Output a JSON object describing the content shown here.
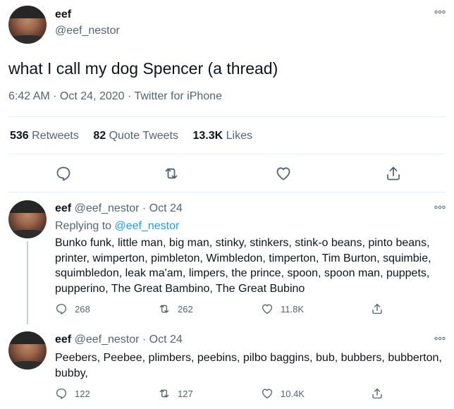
{
  "main": {
    "name": "eef",
    "handle": "@eef_nestor",
    "text": "what I call my dog Spencer (a thread)",
    "meta": "6:42 AM · Oct 24, 2020 · Twitter for iPhone",
    "stats": {
      "retweets_count": "536",
      "retweets_label": "Retweets",
      "quotes_count": "82",
      "quotes_label": "Quote Tweets",
      "likes_count": "13.3K",
      "likes_label": "Likes"
    },
    "icons": [
      "reply-icon",
      "retweet-icon",
      "like-icon",
      "share-icon"
    ]
  },
  "replies": [
    {
      "name": "eef",
      "handle": "@eef_nestor",
      "sep": "·",
      "date": "Oct 24",
      "replying_prefix": "Replying to",
      "replying_to": "@eef_nestor",
      "text": "Bunko funk, little man, big man, stinky, stinkers, stink-o beans, pinto beans, printer, wimperton, pimbleton, Wimbledon, timperton, Tim Burton, squimbie, squimbledon, leak ma'am, limpers, the prince, spoon, spoon man, puppets, pupperino, The Great Bambino, The Great Bubino",
      "replies_count": "268",
      "retweets_count": "262",
      "likes_count": "11.8K"
    },
    {
      "name": "eef",
      "handle": "@eef_nestor",
      "sep": "·",
      "date": "Oct 24",
      "text": "Peebers, Peebee, plimbers, peebins, pilbo baggins, bub, bubbers, bubberton, bubby,",
      "replies_count": "122",
      "retweets_count": "127",
      "likes_count": "10.4K"
    }
  ],
  "colors": {
    "text": "#0f1419",
    "secondary": "#536471",
    "link": "#1d9bf0",
    "divider": "#e6ecf0"
  }
}
